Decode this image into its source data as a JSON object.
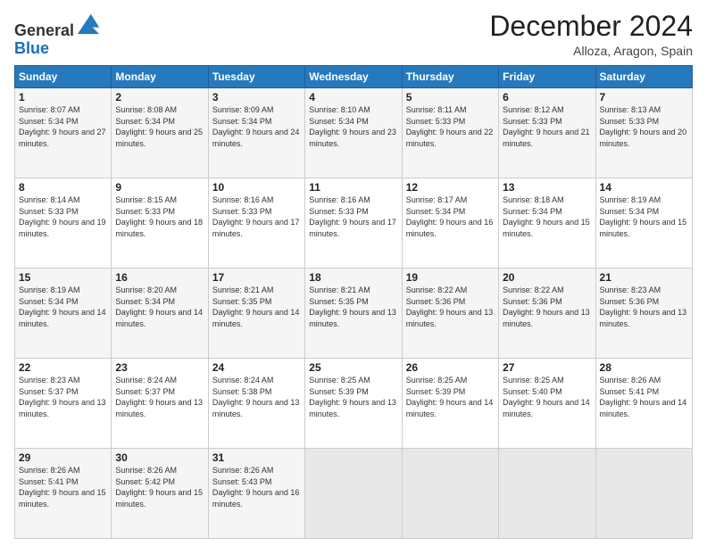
{
  "header": {
    "logo_line1": "General",
    "logo_line2": "Blue",
    "month_title": "December 2024",
    "location": "Alloza, Aragon, Spain"
  },
  "weekdays": [
    "Sunday",
    "Monday",
    "Tuesday",
    "Wednesday",
    "Thursday",
    "Friday",
    "Saturday"
  ],
  "weeks": [
    [
      {
        "day": "1",
        "sunrise": "8:07 AM",
        "sunset": "5:34 PM",
        "daylight": "9 hours and 27 minutes."
      },
      {
        "day": "2",
        "sunrise": "8:08 AM",
        "sunset": "5:34 PM",
        "daylight": "9 hours and 25 minutes."
      },
      {
        "day": "3",
        "sunrise": "8:09 AM",
        "sunset": "5:34 PM",
        "daylight": "9 hours and 24 minutes."
      },
      {
        "day": "4",
        "sunrise": "8:10 AM",
        "sunset": "5:34 PM",
        "daylight": "9 hours and 23 minutes."
      },
      {
        "day": "5",
        "sunrise": "8:11 AM",
        "sunset": "5:33 PM",
        "daylight": "9 hours and 22 minutes."
      },
      {
        "day": "6",
        "sunrise": "8:12 AM",
        "sunset": "5:33 PM",
        "daylight": "9 hours and 21 minutes."
      },
      {
        "day": "7",
        "sunrise": "8:13 AM",
        "sunset": "5:33 PM",
        "daylight": "9 hours and 20 minutes."
      }
    ],
    [
      {
        "day": "8",
        "sunrise": "8:14 AM",
        "sunset": "5:33 PM",
        "daylight": "9 hours and 19 minutes."
      },
      {
        "day": "9",
        "sunrise": "8:15 AM",
        "sunset": "5:33 PM",
        "daylight": "9 hours and 18 minutes."
      },
      {
        "day": "10",
        "sunrise": "8:16 AM",
        "sunset": "5:33 PM",
        "daylight": "9 hours and 17 minutes."
      },
      {
        "day": "11",
        "sunrise": "8:16 AM",
        "sunset": "5:33 PM",
        "daylight": "9 hours and 17 minutes."
      },
      {
        "day": "12",
        "sunrise": "8:17 AM",
        "sunset": "5:34 PM",
        "daylight": "9 hours and 16 minutes."
      },
      {
        "day": "13",
        "sunrise": "8:18 AM",
        "sunset": "5:34 PM",
        "daylight": "9 hours and 15 minutes."
      },
      {
        "day": "14",
        "sunrise": "8:19 AM",
        "sunset": "5:34 PM",
        "daylight": "9 hours and 15 minutes."
      }
    ],
    [
      {
        "day": "15",
        "sunrise": "8:19 AM",
        "sunset": "5:34 PM",
        "daylight": "9 hours and 14 minutes."
      },
      {
        "day": "16",
        "sunrise": "8:20 AM",
        "sunset": "5:34 PM",
        "daylight": "9 hours and 14 minutes."
      },
      {
        "day": "17",
        "sunrise": "8:21 AM",
        "sunset": "5:35 PM",
        "daylight": "9 hours and 14 minutes."
      },
      {
        "day": "18",
        "sunrise": "8:21 AM",
        "sunset": "5:35 PM",
        "daylight": "9 hours and 13 minutes."
      },
      {
        "day": "19",
        "sunrise": "8:22 AM",
        "sunset": "5:36 PM",
        "daylight": "9 hours and 13 minutes."
      },
      {
        "day": "20",
        "sunrise": "8:22 AM",
        "sunset": "5:36 PM",
        "daylight": "9 hours and 13 minutes."
      },
      {
        "day": "21",
        "sunrise": "8:23 AM",
        "sunset": "5:36 PM",
        "daylight": "9 hours and 13 minutes."
      }
    ],
    [
      {
        "day": "22",
        "sunrise": "8:23 AM",
        "sunset": "5:37 PM",
        "daylight": "9 hours and 13 minutes."
      },
      {
        "day": "23",
        "sunrise": "8:24 AM",
        "sunset": "5:37 PM",
        "daylight": "9 hours and 13 minutes."
      },
      {
        "day": "24",
        "sunrise": "8:24 AM",
        "sunset": "5:38 PM",
        "daylight": "9 hours and 13 minutes."
      },
      {
        "day": "25",
        "sunrise": "8:25 AM",
        "sunset": "5:39 PM",
        "daylight": "9 hours and 13 minutes."
      },
      {
        "day": "26",
        "sunrise": "8:25 AM",
        "sunset": "5:39 PM",
        "daylight": "9 hours and 14 minutes."
      },
      {
        "day": "27",
        "sunrise": "8:25 AM",
        "sunset": "5:40 PM",
        "daylight": "9 hours and 14 minutes."
      },
      {
        "day": "28",
        "sunrise": "8:26 AM",
        "sunset": "5:41 PM",
        "daylight": "9 hours and 14 minutes."
      }
    ],
    [
      {
        "day": "29",
        "sunrise": "8:26 AM",
        "sunset": "5:41 PM",
        "daylight": "9 hours and 15 minutes."
      },
      {
        "day": "30",
        "sunrise": "8:26 AM",
        "sunset": "5:42 PM",
        "daylight": "9 hours and 15 minutes."
      },
      {
        "day": "31",
        "sunrise": "8:26 AM",
        "sunset": "5:43 PM",
        "daylight": "9 hours and 16 minutes."
      },
      null,
      null,
      null,
      null
    ]
  ]
}
